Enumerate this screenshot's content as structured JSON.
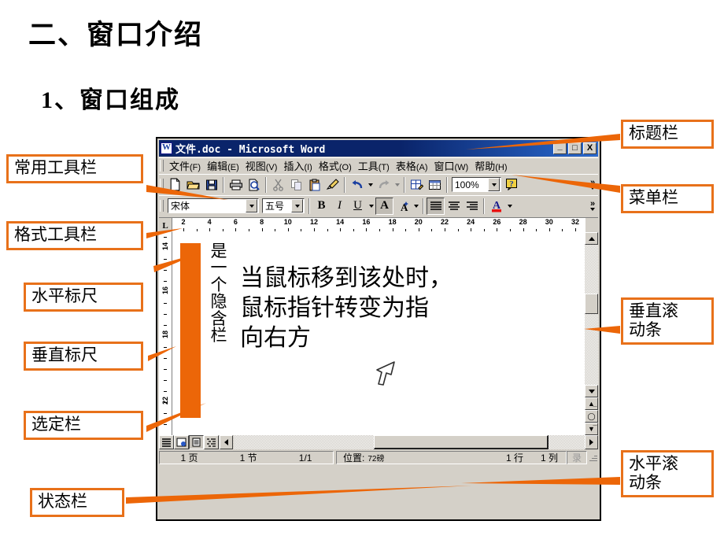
{
  "slide": {
    "heading1": "二、窗口介绍",
    "heading2_number": "1",
    "heading2_text": "、窗口组成"
  },
  "callouts": {
    "left": [
      {
        "id": "standard-toolbar",
        "label": "常用工具栏"
      },
      {
        "id": "formatting-toolbar",
        "label": "格式工具栏"
      },
      {
        "id": "horizontal-ruler",
        "label": "水平标尺"
      },
      {
        "id": "vertical-ruler",
        "label": "垂直标尺"
      },
      {
        "id": "selection-bar",
        "label": "选定栏"
      },
      {
        "id": "status-bar",
        "label": "状态栏"
      }
    ],
    "right": [
      {
        "id": "title-bar",
        "label": "标题栏"
      },
      {
        "id": "menu-bar",
        "label": "菜单栏"
      },
      {
        "id": "vertical-scrollbar",
        "label": "垂直滚\n动条"
      },
      {
        "id": "horizontal-scrollbar",
        "label": "水平滚\n动条"
      }
    ]
  },
  "word": {
    "title": "文件.doc - Microsoft Word",
    "window_buttons": {
      "minimize": "_",
      "maximize": "□",
      "close": "X"
    },
    "menus": [
      {
        "label": "文件",
        "hotkey": "(F)"
      },
      {
        "label": "编辑",
        "hotkey": "(E)"
      },
      {
        "label": "视图",
        "hotkey": "(V)"
      },
      {
        "label": "插入",
        "hotkey": "(I)"
      },
      {
        "label": "格式",
        "hotkey": "(O)"
      },
      {
        "label": "工具",
        "hotkey": "(T)"
      },
      {
        "label": "表格",
        "hotkey": "(A)"
      },
      {
        "label": "窗口",
        "hotkey": "(W)"
      },
      {
        "label": "帮助",
        "hotkey": "(H)"
      }
    ],
    "standard_toolbar": {
      "buttons": [
        "new-document-icon",
        "open-folder-icon",
        "save-icon",
        "print-icon",
        "print-preview-icon",
        "cut-scissors-icon",
        "copy-icon",
        "paste-clipboard-icon",
        "format-painter-icon",
        "undo-icon",
        "redo-icon",
        "insert-hyperlink-icon",
        "insert-table-icon"
      ],
      "zoom_value": "100%",
      "help_label": "?",
      "overflow_label": "»"
    },
    "formatting_toolbar": {
      "font_name": "宋体",
      "font_size": "五号",
      "bold_label": "B",
      "italic_label": "I",
      "underline_label": "U",
      "font_color_label": "A",
      "highlight_label": "A",
      "align_left_icon": "align-left-icon",
      "align_center_icon": "align-center-icon",
      "align_right_icon": "align-right-icon",
      "overflow_label": "»"
    },
    "horizontal_ruler": {
      "tab_marker": "L",
      "ticks": [
        2,
        4,
        6,
        8,
        10,
        12,
        14,
        16,
        18,
        20,
        22,
        24,
        26,
        28,
        30,
        32
      ]
    },
    "vertical_ruler": {
      "ticks": [
        14,
        16,
        18,
        22
      ]
    },
    "document": {
      "vertical_text": [
        "是",
        "一",
        "个",
        "隐",
        "含",
        "栏"
      ],
      "lines": [
        "当鼠标移到该处时，",
        "鼠标指针转变为指",
        "向右方"
      ],
      "cursor": "right-pointing-arrow-cursor"
    },
    "view_buttons": [
      "normal-view-icon",
      "web-layout-view-icon",
      "print-layout-view-icon",
      "outline-view-icon"
    ],
    "status_bar": {
      "page": "1 页",
      "section": "1 节",
      "pages": "1/1",
      "position_label": "位置:",
      "position_value": "72磅",
      "line": "1 行",
      "column": "1 列",
      "record": "录"
    }
  },
  "colors": {
    "accent_orange": "#EC6608",
    "callout_border": "#E8711A",
    "titlebar_blue": "#0a246a",
    "chrome_gray": "#d4d0c8"
  }
}
